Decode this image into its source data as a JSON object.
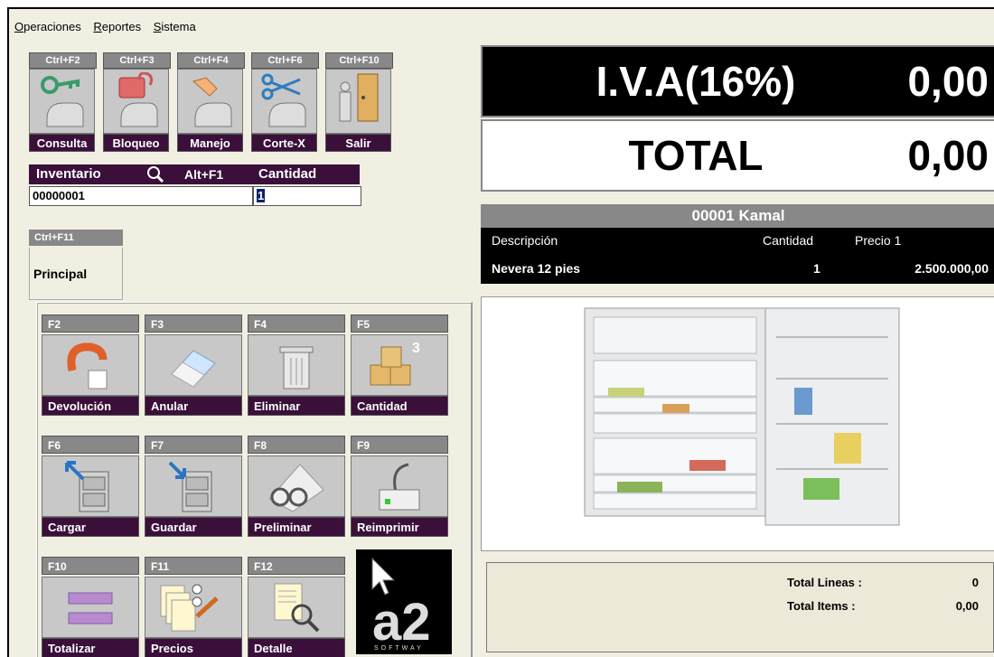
{
  "menu": [
    {
      "mnemonic": "O",
      "rest": "peraciones"
    },
    {
      "mnemonic": "R",
      "rest": "eportes"
    },
    {
      "mnemonic": "S",
      "rest": "istema"
    }
  ],
  "toolbar": [
    {
      "key": "Ctrl+F2",
      "label": "Consulta",
      "icon": "key-icon"
    },
    {
      "key": "Ctrl+F3",
      "label": "Bloqueo",
      "icon": "padlock-icon"
    },
    {
      "key": "Ctrl+F4",
      "label": "Manejo",
      "icon": "hand-icon"
    },
    {
      "key": "Ctrl+F6",
      "label": "Corte-X",
      "icon": "scissors-icon"
    },
    {
      "key": "Ctrl+F10",
      "label": "Salir",
      "icon": "exit-door-icon"
    }
  ],
  "inventory": {
    "label": "Inventario",
    "search_shortcut": "Alt+F1",
    "value": "00000001",
    "quantity_label": "Cantidad",
    "quantity_value": "1"
  },
  "principal": {
    "key": "Ctrl+F11",
    "label": "Principal"
  },
  "fkeys": [
    {
      "key": "F2",
      "label": "Devolución",
      "icon": "return-arrow-icon"
    },
    {
      "key": "F3",
      "label": "Anular",
      "icon": "eraser-icon"
    },
    {
      "key": "F4",
      "label": "Eliminar",
      "icon": "trash-can-icon"
    },
    {
      "key": "F5",
      "label": "Cantidad",
      "icon": "boxes-icon",
      "badge": "3"
    },
    {
      "key": "F6",
      "label": "Cargar",
      "icon": "load-cabinet-icon"
    },
    {
      "key": "F7",
      "label": "Guardar",
      "icon": "save-cabinet-icon"
    },
    {
      "key": "F8",
      "label": "Preliminar",
      "icon": "glasses-icon"
    },
    {
      "key": "F9",
      "label": "Reimprimir",
      "icon": "printer-icon"
    },
    {
      "key": "F10",
      "label": "Totalizar",
      "icon": "equals-icon"
    },
    {
      "key": "F11",
      "label": "Precios",
      "icon": "price-tags-icon"
    },
    {
      "key": "F12",
      "label": "Detalle",
      "icon": "magnifier-doc-icon"
    }
  ],
  "logo": {
    "text": "a2",
    "subtext": "SOFTWAY"
  },
  "display": {
    "iva_label": "I.V.A(16%)",
    "iva_value": "0,00",
    "total_label": "TOTAL",
    "total_value": "0,00"
  },
  "customer": "00001 Kamal",
  "columns": {
    "description": "Descripción",
    "quantity": "Cantidad",
    "price": "Precio 1"
  },
  "item": {
    "description": "Nevera 12 pies",
    "quantity": "1",
    "price": "2.500.000,00"
  },
  "totals": {
    "lines_label": "Total Lineas :",
    "lines_value": "0",
    "items_label": "Total Items :",
    "items_value": "0,00"
  }
}
